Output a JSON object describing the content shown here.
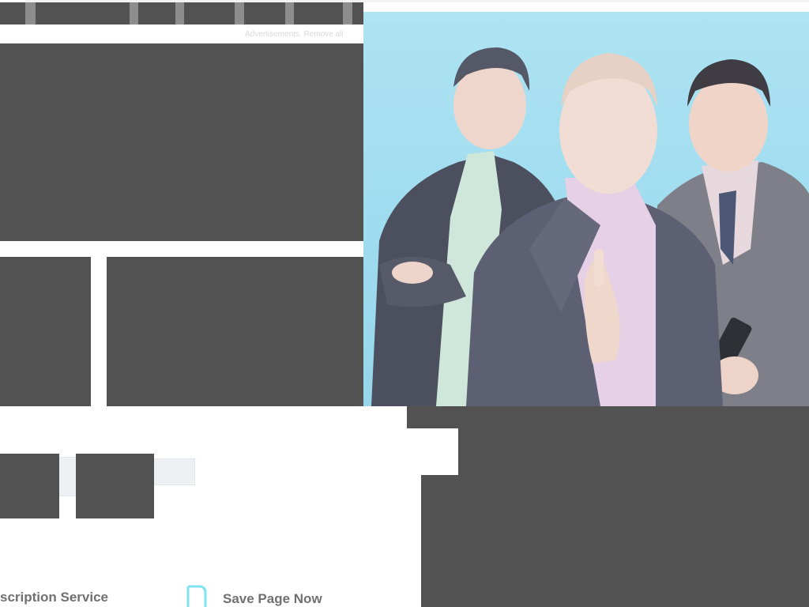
{
  "top_nav": {
    "slots": [
      "",
      "",
      "",
      "",
      "",
      ""
    ]
  },
  "ad_notice": {
    "text": "Advertisements. Remove all"
  },
  "hero": {
    "colors": {
      "background": "#9fdcef",
      "suit_dark": "#4a4d5c",
      "suit_mid": "#5f6272",
      "vest_grey": "#8a8b93",
      "skin": "#efd6cc",
      "shirt_mint": "#cde7da",
      "shirt_pink": "#e7d3e8"
    }
  },
  "footer": {
    "subscription_label": "scription Service",
    "save_page_label": "Save Page Now",
    "save_page_icon": "bookmark-icon",
    "icon_color": "#7fe3ef"
  }
}
